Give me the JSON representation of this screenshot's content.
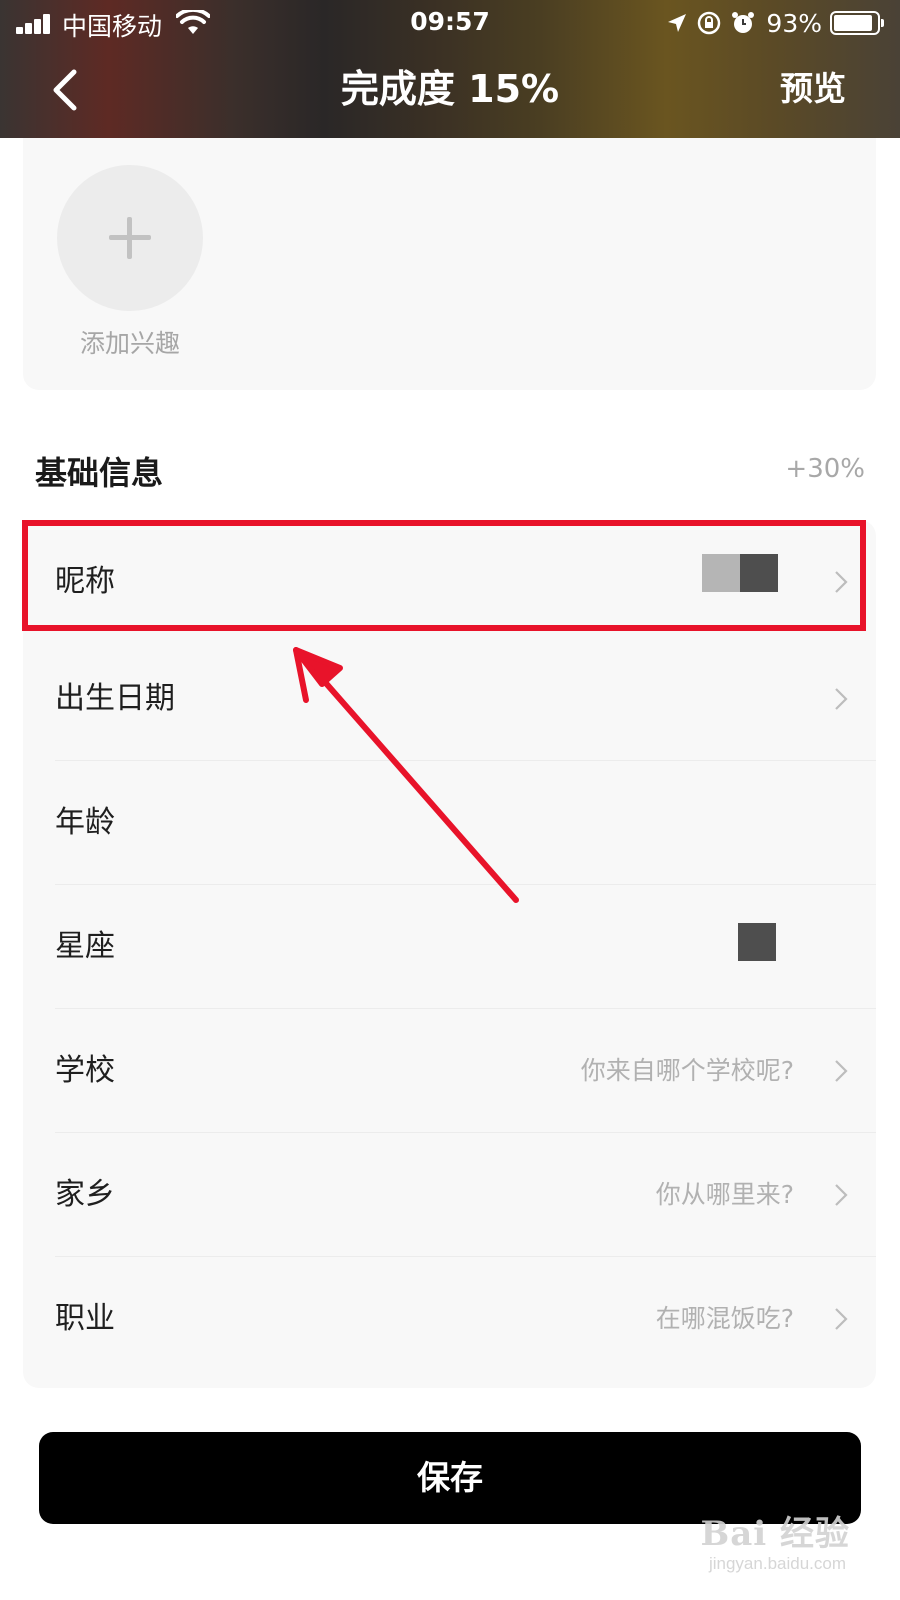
{
  "status_bar": {
    "carrier": "中国移动",
    "time": "09:57",
    "battery": "93%",
    "battery_level": 0.93,
    "signal_bars": 4
  },
  "nav": {
    "title": "完成度 15%",
    "preview_label": "预览"
  },
  "interests": {
    "add_label": "添加兴趣"
  },
  "basic_info": {
    "title": "基础信息",
    "bonus": "+30%",
    "rows": [
      {
        "label": "昵称",
        "value": "",
        "has_arrow": true
      },
      {
        "label": "出生日期",
        "value": "",
        "has_arrow": true
      },
      {
        "label": "年龄",
        "value": "",
        "has_arrow": false
      },
      {
        "label": "星座",
        "value": "",
        "has_arrow": false
      },
      {
        "label": "学校",
        "value": "你来自哪个学校呢?",
        "has_arrow": true
      },
      {
        "label": "家乡",
        "value": "你从哪里来?",
        "has_arrow": true
      },
      {
        "label": "职业",
        "value": "在哪混饭吃?",
        "has_arrow": true
      }
    ]
  },
  "save_label": "保存",
  "watermark": {
    "main": "Bai 经验",
    "sub": "jingyan.baidu.com"
  },
  "annotation_color": "#e8132a"
}
